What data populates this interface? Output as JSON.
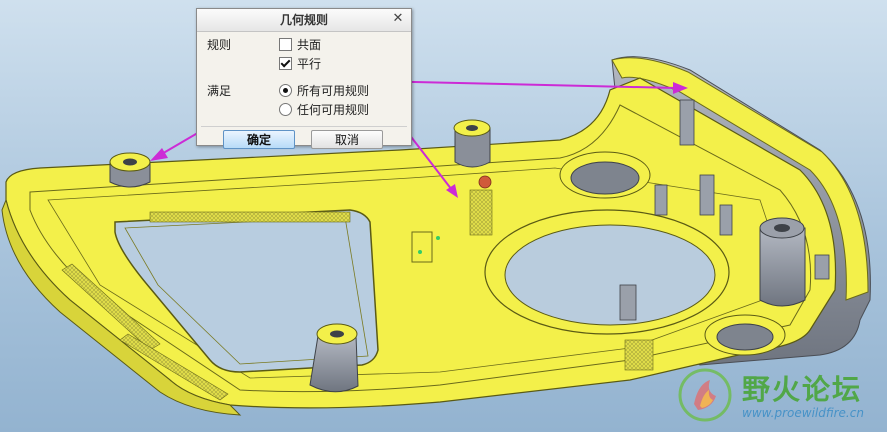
{
  "dialog": {
    "title": "几何规则",
    "close_glyph": "✕",
    "rules_label": "规则",
    "coplanar_label": "共面",
    "coplanar_checked": false,
    "parallel_label": "平行",
    "parallel_checked": true,
    "satisfy_label": "满足",
    "all_rules_label": "所有可用规则",
    "any_rule_label": "任何可用规则",
    "selected_option": "所有可用规则",
    "ok_label": "确定",
    "cancel_label": "取消"
  },
  "watermark": {
    "text": "野火论坛",
    "url": "www.proewildfire.cn"
  },
  "colors": {
    "highlight_box": "#e2161c",
    "arrow": "#cc2bd6",
    "part_yellow": "#f3f04a",
    "part_gray": "#8a8f99",
    "background": "#a9c4dc"
  },
  "icons": {
    "close": "close-icon",
    "logo": "forum-logo-icon"
  }
}
